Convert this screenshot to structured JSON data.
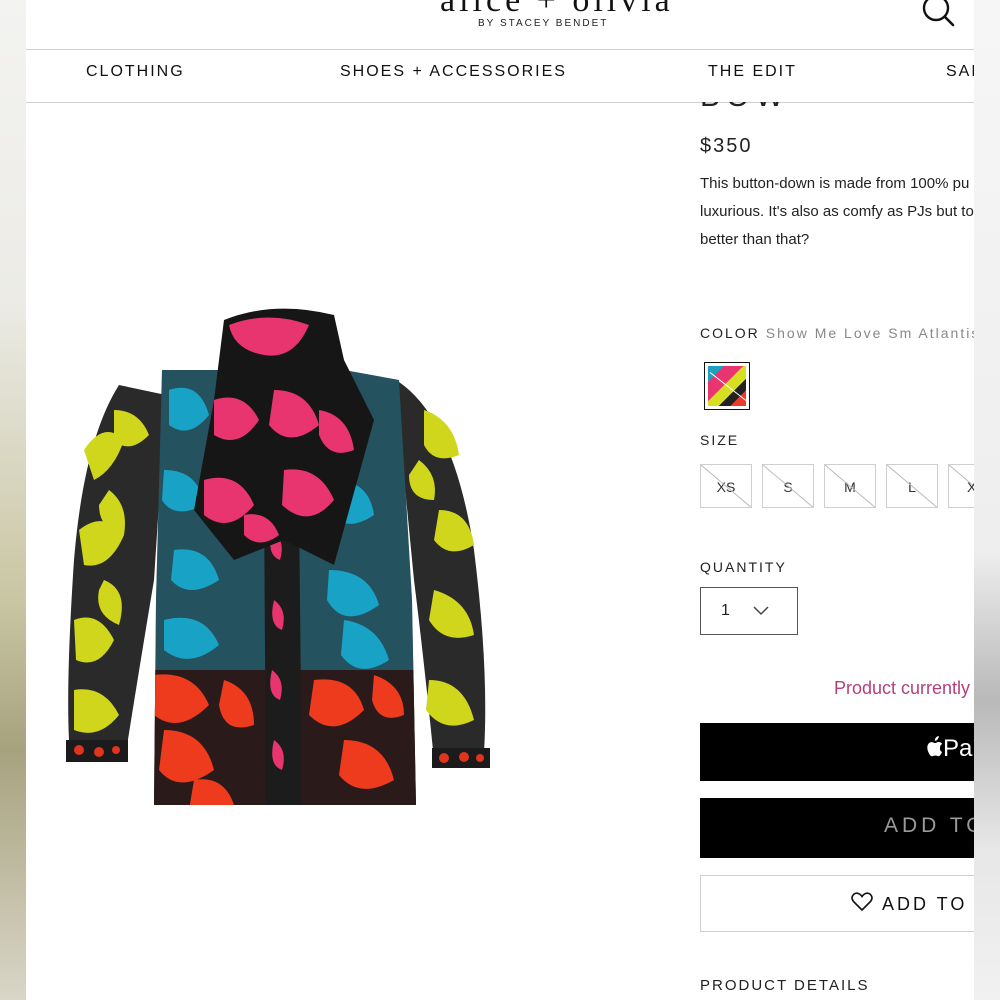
{
  "header": {
    "logo": "alice + olivia",
    "byline": "BY STACEY BENDET"
  },
  "nav": {
    "items": [
      "CLOTHING",
      "SHOES + ACCESSORIES",
      "THE EDIT",
      "SAL"
    ]
  },
  "product": {
    "title_fragment": "BOW",
    "price": "$350",
    "description_lines": [
      "This button-down is made from 100% pu",
      "luxurious. It's also as comfy as PJs but to",
      "better than that?"
    ],
    "color_label": "COLOR",
    "color_value": "Show Me Love Sm Atlantis/",
    "size_label": "SIZE",
    "sizes": [
      "XS",
      "S",
      "M",
      "L",
      "X"
    ],
    "quantity_label": "QUANTITY",
    "quantity_value": "1",
    "availability": "Product currently",
    "apple_pay_label": "Pa",
    "add_to_bag_label": "ADD TO",
    "wishlist_label": "ADD TO V",
    "details_label": "PRODUCT DETAILS"
  },
  "colors": {
    "availability_text": "#b2417a",
    "button_bg": "#000000",
    "add_to_bag_text": "#9a9a9a"
  },
  "icons": {
    "search": "search-icon",
    "chevron": "chevron-down-icon",
    "heart": "heart-icon",
    "apple": "apple-icon"
  }
}
